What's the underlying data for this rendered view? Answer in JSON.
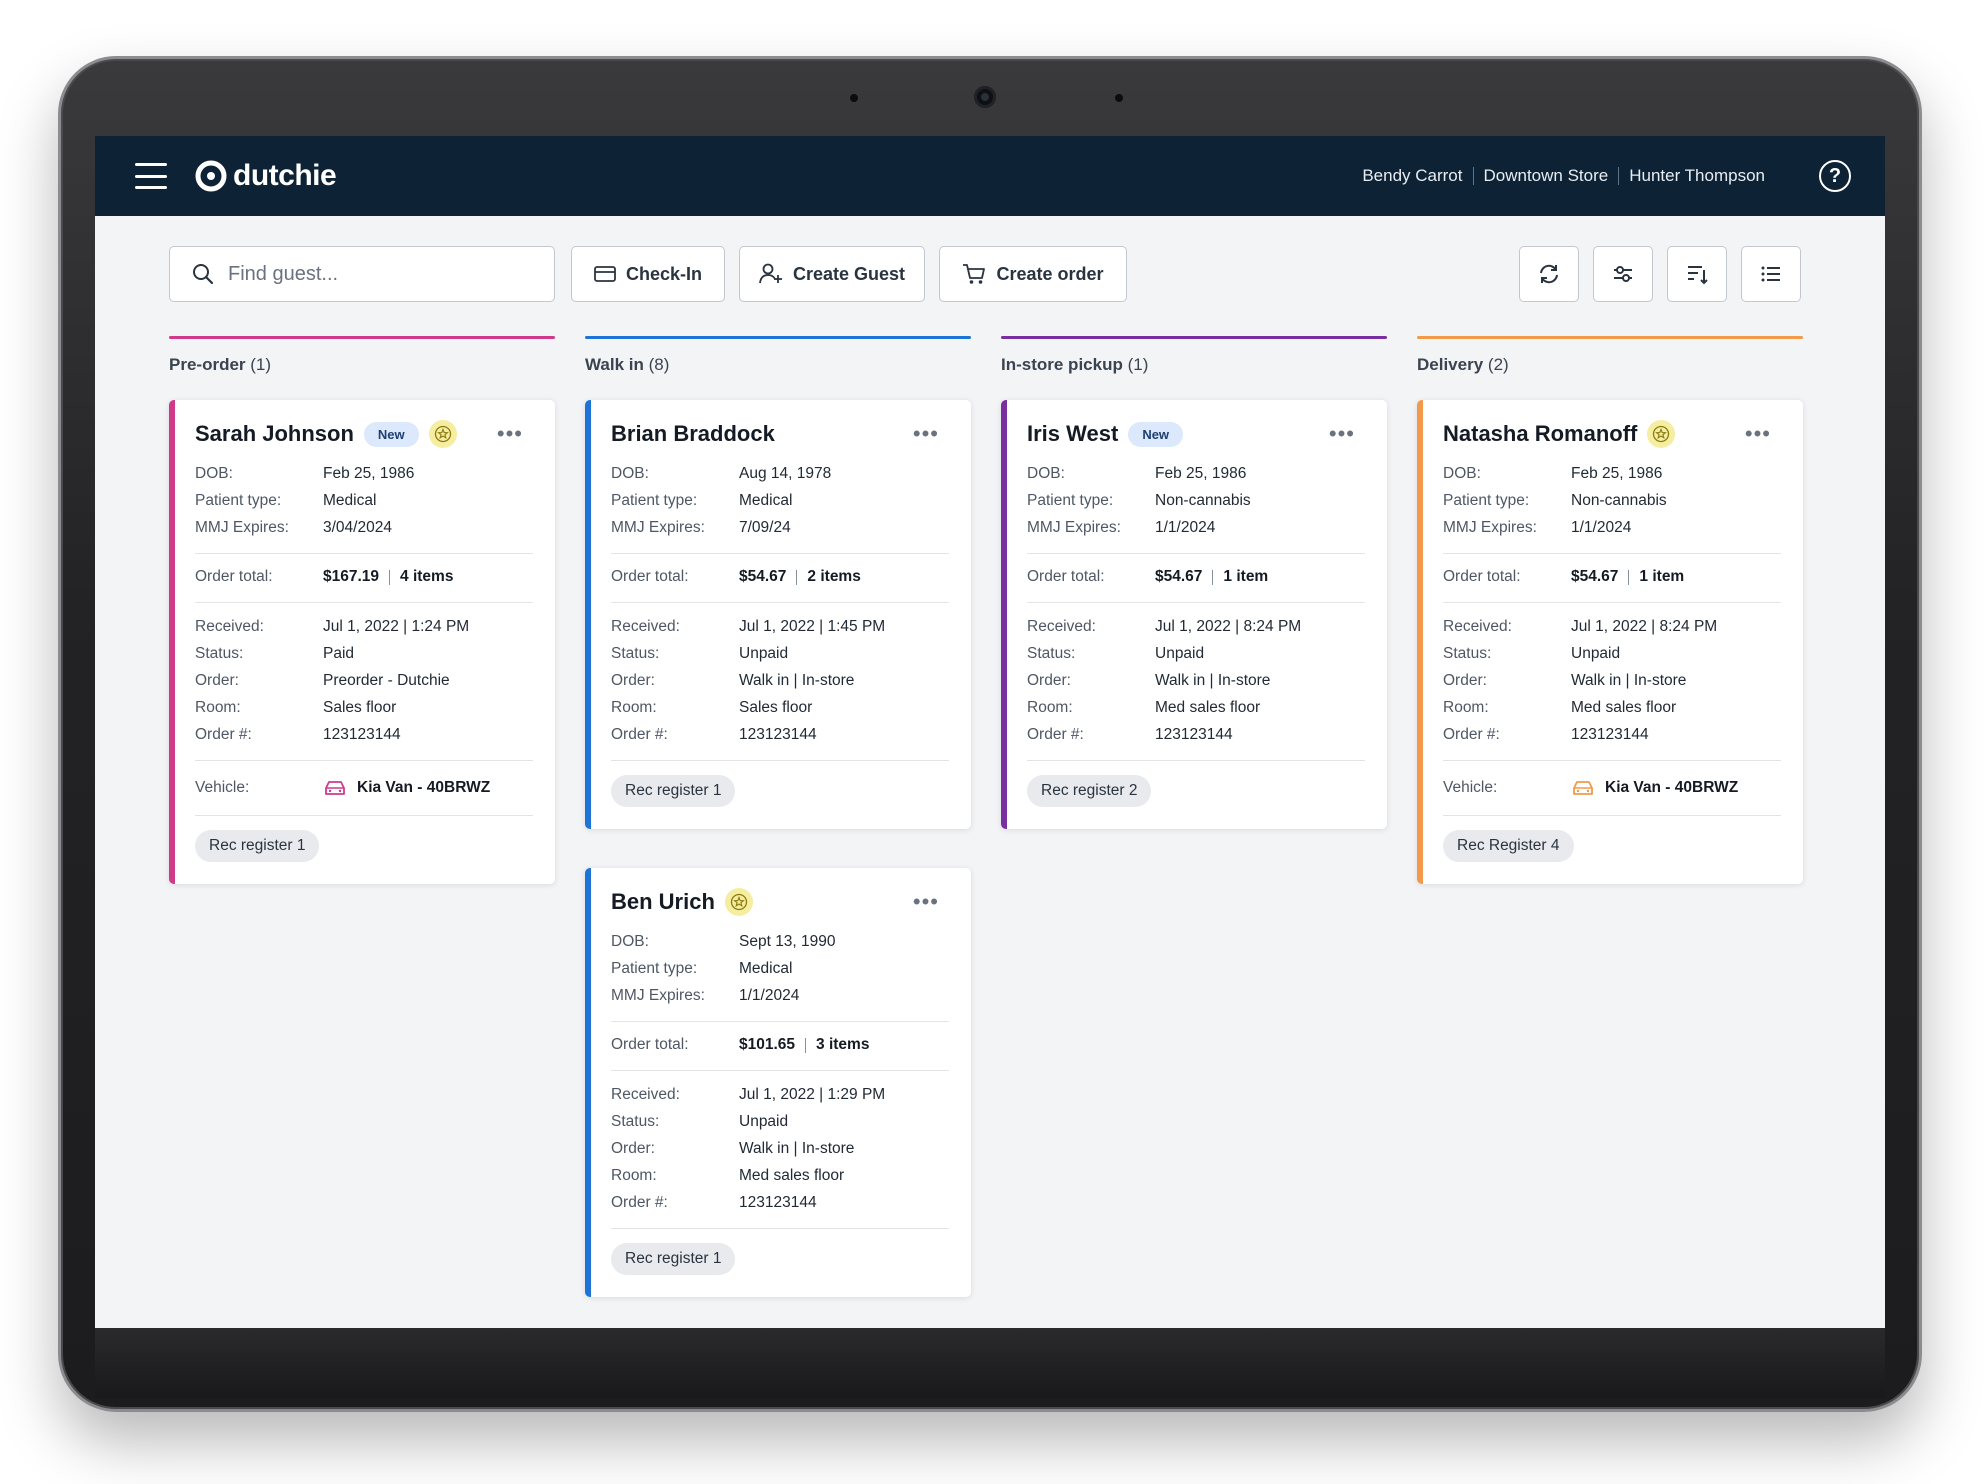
{
  "app": {
    "name": "dutchie"
  },
  "header": {
    "crumbs": [
      "Bendy Carrot",
      "Downtown Store",
      "Hunter Thompson"
    ],
    "help": "?"
  },
  "toolbar": {
    "search_placeholder": "Find guest...",
    "checkin_label": "Check-In",
    "create_guest_label": "Create Guest",
    "create_order_label": "Create order"
  },
  "labels": {
    "dob": "DOB:",
    "patient_type": "Patient type:",
    "mmj_expires": "MMJ Expires:",
    "order_total": "Order total:",
    "received": "Received:",
    "status": "Status:",
    "order": "Order:",
    "room": "Room:",
    "order_no": "Order #:",
    "vehicle": "Vehicle:",
    "new": "New",
    "more": "•••"
  },
  "colors": {
    "preorder": "#cf3a8a",
    "walkin": "#1e74d6",
    "pickup": "#7a2fa0",
    "delivery": "#f29a4a"
  },
  "columns": [
    {
      "title": "Pre-order",
      "count": "(1)",
      "cards": [
        {
          "name": "Sarah Johnson",
          "dob": "Feb 25, 1986",
          "patient_type": "Medical",
          "mmj": "3/04/2024",
          "total": "$167.19",
          "items": "4 items",
          "received": "Jul 1, 2022 | 1:24 PM",
          "status": "Paid",
          "order": "Preorder - Dutchie",
          "room": "Sales floor",
          "order_no": "123123144",
          "vehicle": "Kia Van - 40BRWZ",
          "register": "Rec register 1"
        }
      ]
    },
    {
      "title": "Walk in",
      "count": "(8)",
      "cards": [
        {
          "name": "Brian Braddock",
          "dob": "Aug 14, 1978",
          "patient_type": "Medical",
          "mmj": "7/09/24",
          "total": "$54.67",
          "items": "2 items",
          "received": "Jul 1, 2022 | 1:45 PM",
          "status": "Unpaid",
          "order": "Walk in | In-store",
          "room": "Sales floor",
          "order_no": "123123144",
          "register": "Rec register 1"
        },
        {
          "name": "Ben Urich",
          "dob": "Sept 13, 1990",
          "patient_type": "Medical",
          "mmj": "1/1/2024",
          "total": "$101.65",
          "items": "3 items",
          "received": "Jul 1, 2022 | 1:29 PM",
          "status": "Unpaid",
          "order": "Walk in | In-store",
          "room": "Med sales floor",
          "order_no": "123123144",
          "register": "Rec register 1"
        }
      ]
    },
    {
      "title": "In-store pickup",
      "count": "(1)",
      "cards": [
        {
          "name": "Iris West",
          "dob": "Feb 25, 1986",
          "patient_type": "Non-cannabis",
          "mmj": "1/1/2024",
          "total": "$54.67",
          "items": "1 item",
          "received": "Jul 1, 2022 | 8:24 PM",
          "status": "Unpaid",
          "order": "Walk in | In-store",
          "room": "Med sales floor",
          "order_no": "123123144",
          "register": "Rec register 2"
        }
      ]
    },
    {
      "title": "Delivery",
      "count": "(2)",
      "cards": [
        {
          "name": "Natasha Romanoff",
          "dob": "Feb 25, 1986",
          "patient_type": "Non-cannabis",
          "mmj": "1/1/2024",
          "total": "$54.67",
          "items": "1 item",
          "received": "Jul 1, 2022 | 8:24 PM",
          "status": "Unpaid",
          "order": "Walk in | In-store",
          "room": "Med sales floor",
          "order_no": "123123144",
          "vehicle": "Kia Van - 40BRWZ",
          "register": "Rec Register 4"
        }
      ]
    }
  ]
}
